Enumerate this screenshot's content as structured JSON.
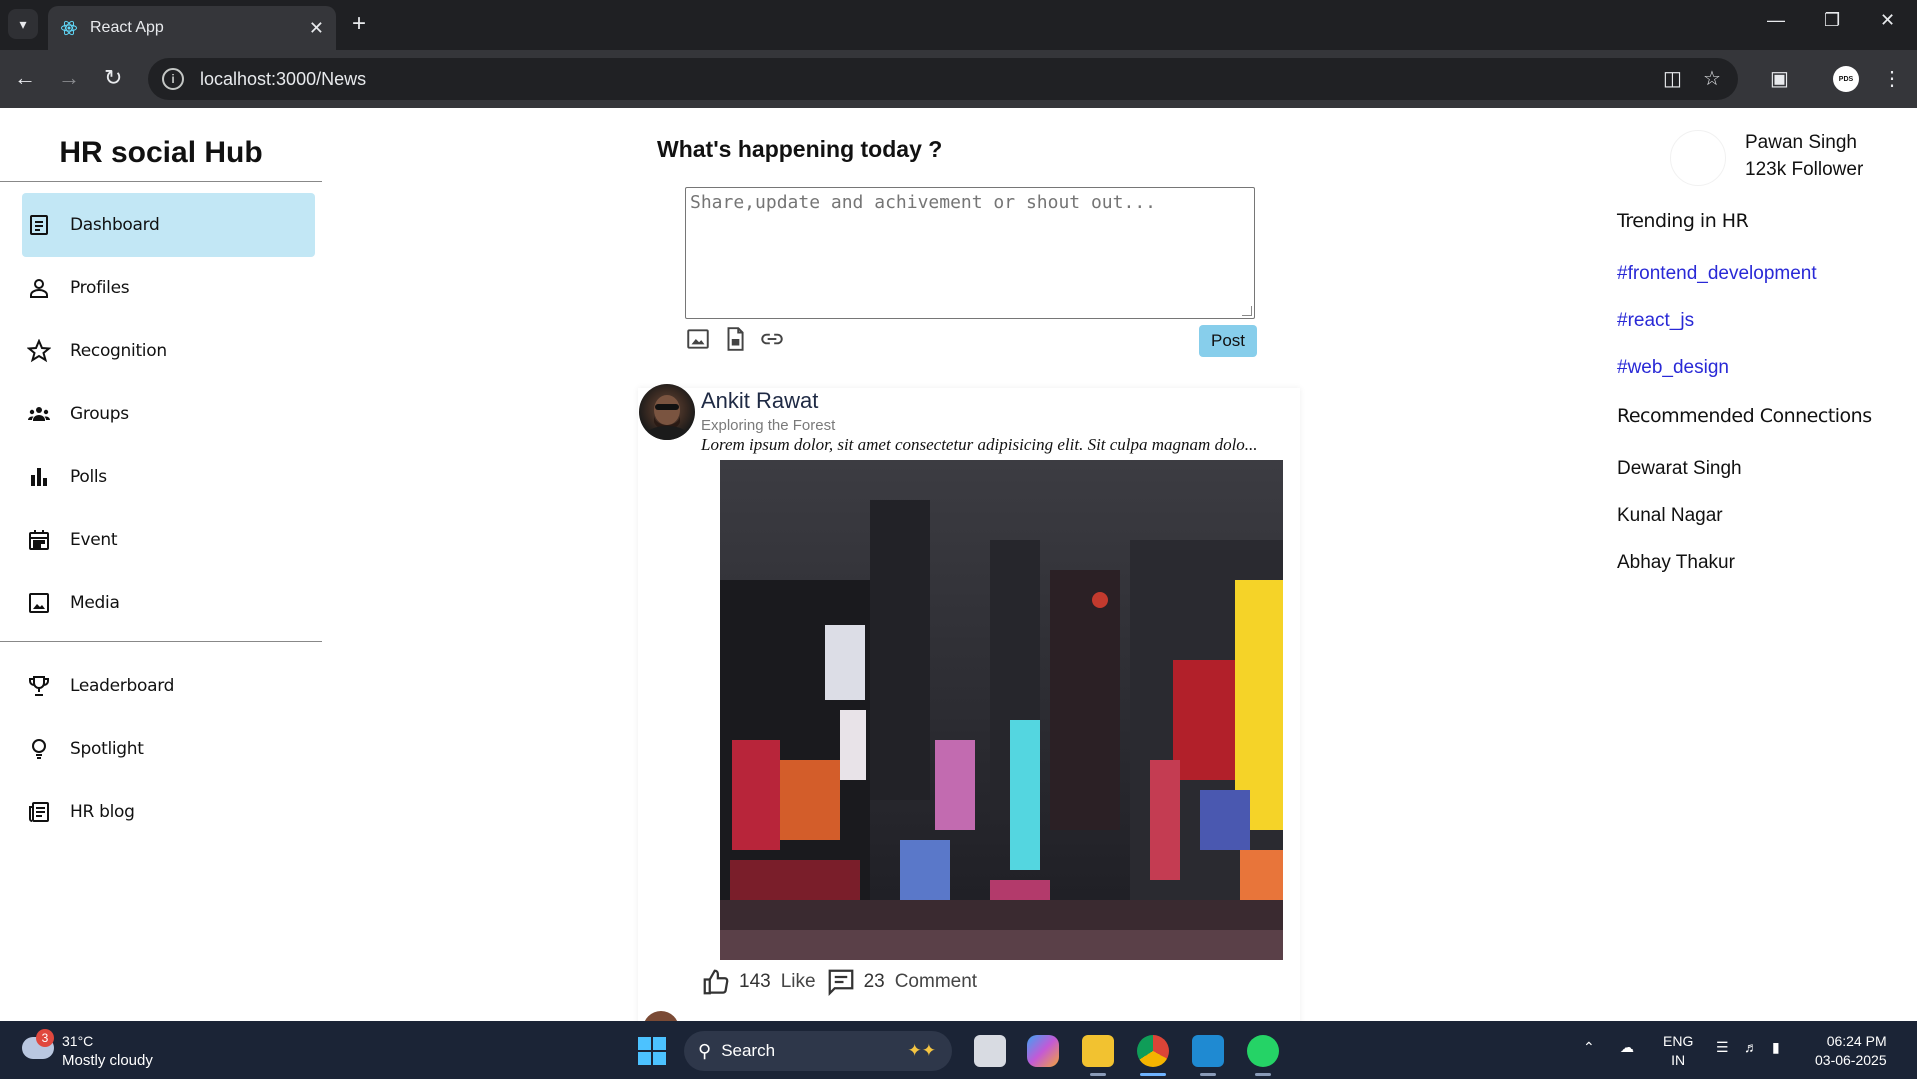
{
  "browser": {
    "tab_title": "React App",
    "url": "localhost:3000/News"
  },
  "sidebar": {
    "brand": "HR social Hub",
    "items": [
      {
        "label": "Dashboard",
        "icon": "document-icon",
        "active": true
      },
      {
        "label": "Profiles",
        "icon": "person-icon"
      },
      {
        "label": "Recognition",
        "icon": "star-icon"
      },
      {
        "label": "Groups",
        "icon": "groups-icon"
      },
      {
        "label": "Polls",
        "icon": "bar-chart-icon"
      },
      {
        "label": "Event",
        "icon": "calendar-icon"
      },
      {
        "label": "Media",
        "icon": "image-icon"
      }
    ],
    "secondary": [
      {
        "label": "Leaderboard",
        "icon": "trophy-icon"
      },
      {
        "label": "Spotlight",
        "icon": "lightbulb-icon"
      },
      {
        "label": "HR blog",
        "icon": "newspaper-icon"
      }
    ]
  },
  "composer": {
    "title": "What's happening today ?",
    "placeholder": "Share,update and achivement or shout out...",
    "post_label": "Post"
  },
  "post": {
    "author": "Ankit Rawat",
    "subtitle": "Exploring the Forest",
    "excerpt": "Lorem ipsum dolor, sit amet consectetur adipisicing elit. Sit culpa magnam dolo...",
    "likes": "143",
    "like_label": "Like",
    "comments": "23",
    "comment_label": "Comment"
  },
  "profile": {
    "name": "Pawan Singh",
    "followers": "123k Follower"
  },
  "trending": {
    "heading": "Trending in HR",
    "tags": [
      "#frontend_development",
      "#react_js",
      "#web_design"
    ]
  },
  "recommended": {
    "heading": "Recommended Connections",
    "people": [
      "Dewarat Singh",
      "Kunal Nagar",
      "Abhay Thakur"
    ]
  },
  "taskbar": {
    "weather_badge": "3",
    "temperature": "31°C",
    "weather": "Mostly cloudy",
    "search_label": "Search",
    "lang_line1": "ENG",
    "lang_line2": "IN",
    "time": "06:24 PM",
    "date": "03-06-2025"
  },
  "colors": {
    "active_nav": "#c2e7f5",
    "post_button": "#87ceeb",
    "hashtag": "#2929d6"
  }
}
